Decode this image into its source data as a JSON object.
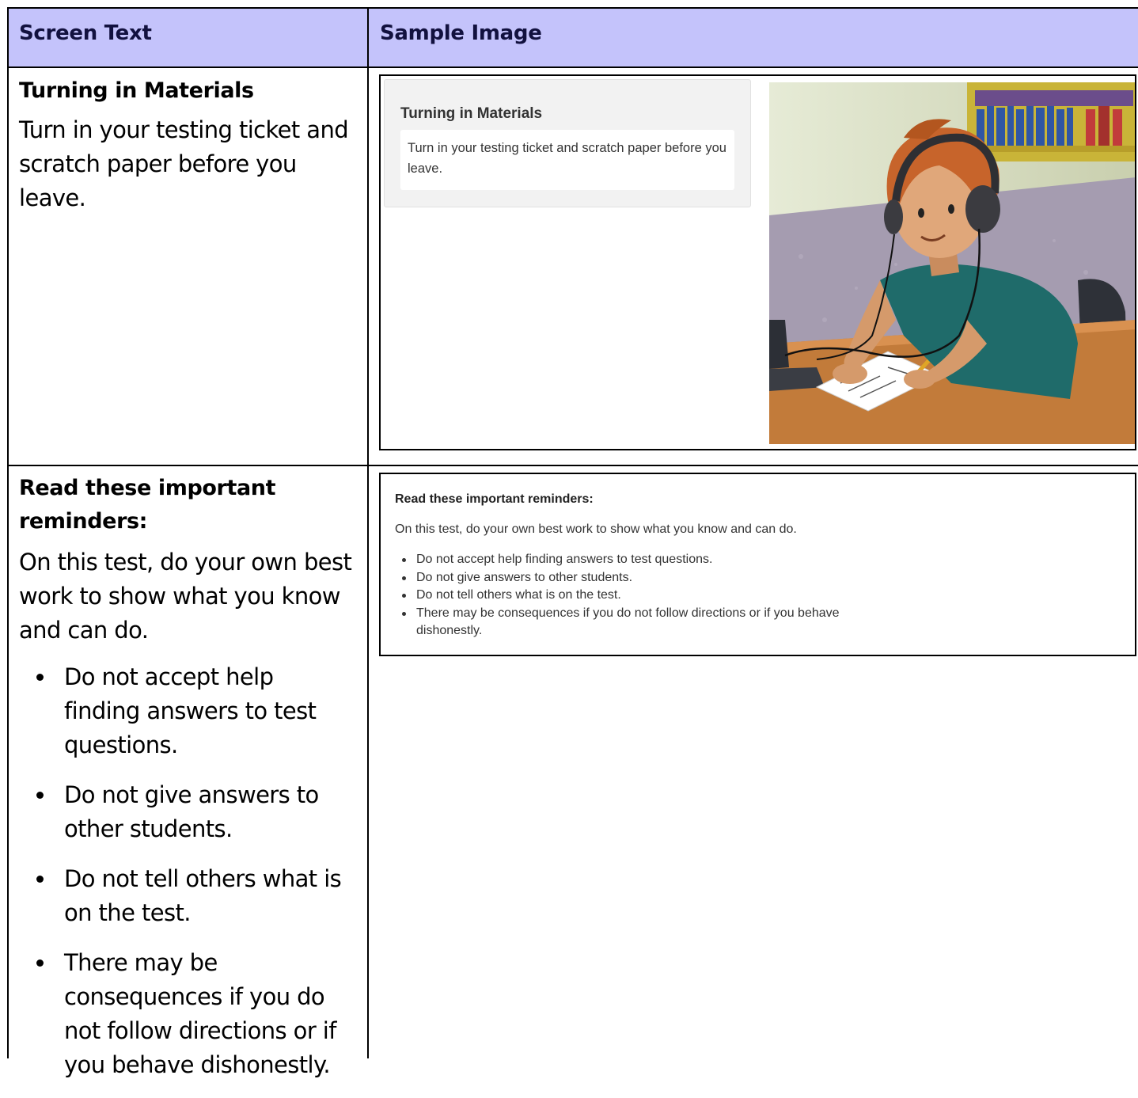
{
  "table": {
    "headers": [
      "Screen Text",
      "Sample Image"
    ]
  },
  "rows": [
    {
      "title": "Turning in Materials",
      "body": "Turn in your testing ticket and scratch paper before you leave.",
      "sample": {
        "card_title": "Turning in Materials",
        "card_text": "Turn in your testing ticket and scratch paper before you leave."
      }
    },
    {
      "title": "Read these important reminders:",
      "body": "On this test, do your own best work to show what you know and can do.",
      "items": [
        "Do not accept help finding answers to test questions.",
        "Do not give answers to other students.",
        "Do not tell others what is on the test.",
        "There may be consequences if you do not follow directions or if you behave dishonestly."
      ],
      "sample": {
        "title": "Read these important reminders:",
        "body": "On this test, do your own best work to show what you know and can do.",
        "items": [
          "Do not accept help finding answers to test questions.",
          "Do not give answers to other students.",
          "Do not tell others what is on the test.",
          "There may be consequences if you do not follow directions or if you behave dishonestly."
        ]
      }
    }
  ],
  "colors": {
    "header_bg": "#c4c3fb",
    "header_text": "#12113f",
    "border": "#000000"
  }
}
